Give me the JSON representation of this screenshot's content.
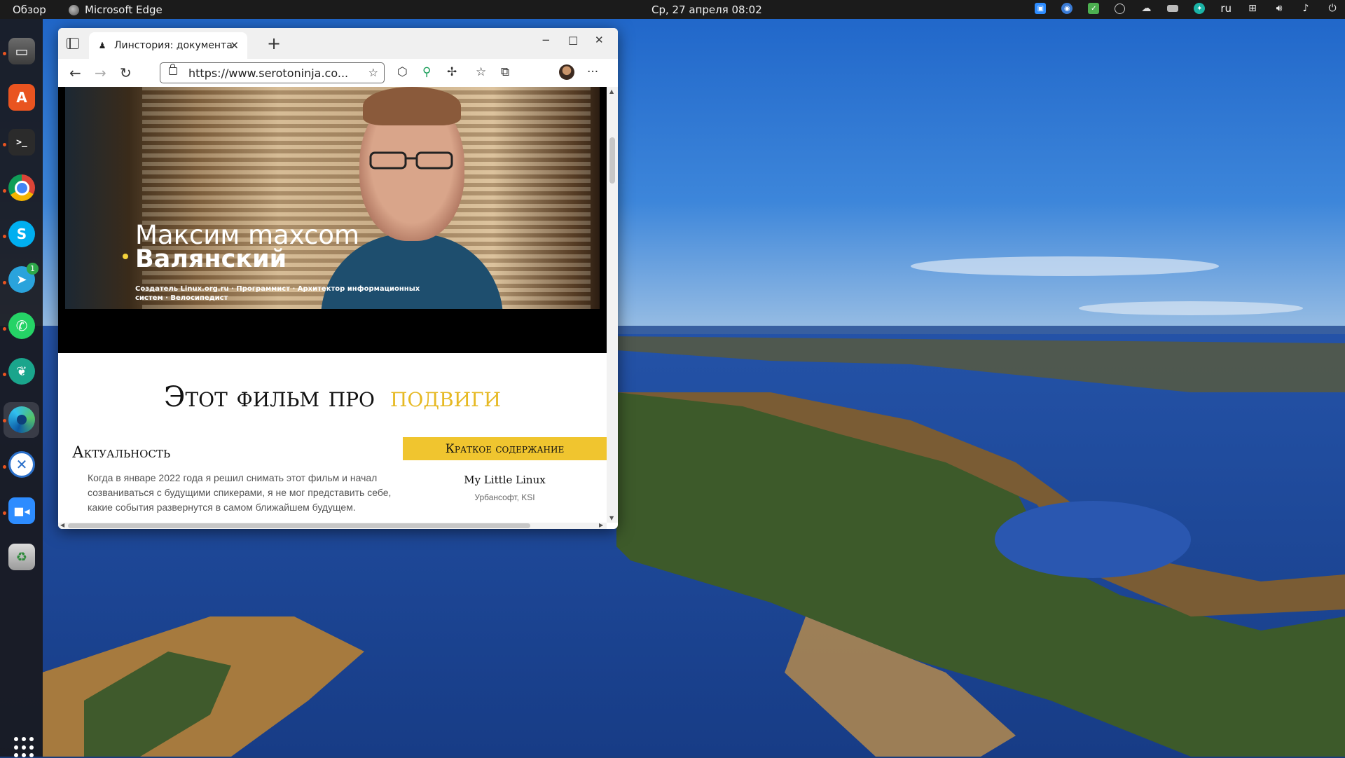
{
  "topbar": {
    "overview": "Обзор",
    "active_app": "Microsoft Edge",
    "clock": "Ср, 27 апреля  08:02",
    "language": "ru",
    "tray_icons": [
      "zoom-icon",
      "vpn-icon",
      "check-icon",
      "whatsapp-icon",
      "weather-icon",
      "card-icon",
      "network-app-icon",
      "network-icon",
      "volume-icon",
      "microphone-icon",
      "power-icon"
    ]
  },
  "dock": {
    "items": [
      {
        "name": "files",
        "icon": "files-icon"
      },
      {
        "name": "app-center",
        "icon": "app-center-icon"
      },
      {
        "name": "terminal",
        "icon": "terminal-icon"
      },
      {
        "name": "chrome",
        "icon": "chrome-icon"
      },
      {
        "name": "skype",
        "icon": "skype-icon"
      },
      {
        "name": "telegram",
        "icon": "telegram-icon",
        "badge": "1"
      },
      {
        "name": "whatsapp",
        "icon": "whatsapp-icon"
      },
      {
        "name": "teams",
        "icon": "bird-icon"
      },
      {
        "name": "edge",
        "icon": "edge-icon"
      },
      {
        "name": "remote-desktop",
        "icon": "remote-icon"
      },
      {
        "name": "zoom",
        "icon": "zoom-icon"
      },
      {
        "name": "trash",
        "icon": "trash-icon"
      }
    ],
    "show_apps_icon": "apps-grid-icon"
  },
  "browser": {
    "tab": {
      "title": "Линстория: документальный",
      "favicon": "ninja-icon"
    },
    "address": {
      "url": "https://www.serotoninja.co..."
    },
    "window_controls": {
      "minimize": "−",
      "maximize": "□",
      "close": "✕"
    },
    "new_tab": "+"
  },
  "page": {
    "video": {
      "name_line1": "Максим maxcom",
      "name_line2": "Валянский",
      "caption": "Создатель Linux.org.ru · Программист · Архитектор информационных систем · Велосипедист"
    },
    "headline": {
      "part1": "Этот фильм про",
      "part2": "подвиги"
    },
    "relevance": {
      "title": "Актуальность",
      "text": "Когда в январе 2022 года я решил снимать этот фильм и начал созваниваться с будущими спикерами, я не мог представить себе, какие события развернутся в самом ближайшем будущем."
    },
    "summary": {
      "bar": "Краткое содержание",
      "item_title": "My Little Linux",
      "item_sub": "Урбансофт, KSI"
    }
  },
  "colors": {
    "accent_gold": "#e6b923",
    "summary_bar": "#f0c52f",
    "ubuntu_orange": "#e95420"
  }
}
